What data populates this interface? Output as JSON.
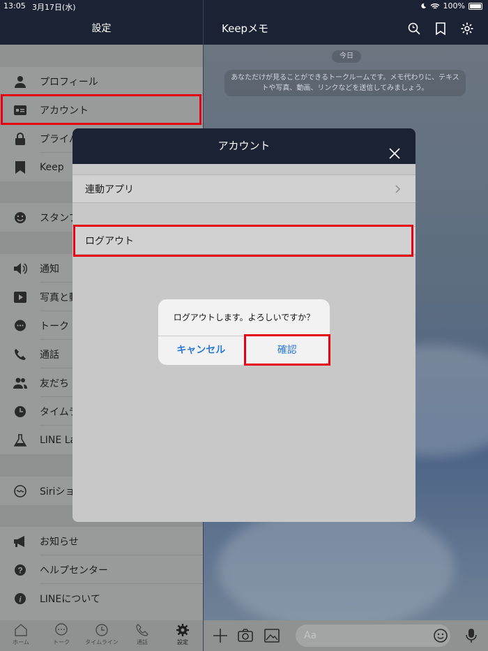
{
  "status": {
    "time": "13:05",
    "date": "3月17日(水)",
    "battery": "100%"
  },
  "left_nav": {
    "title": "設定"
  },
  "right_nav": {
    "title": "Keepメモ",
    "icons": [
      "search-icon",
      "bookmark-icon",
      "gear-icon"
    ]
  },
  "settings": {
    "items": [
      {
        "label": "プロフィール",
        "icon": "person-icon"
      },
      {
        "label": "アカウント",
        "icon": "id-card-icon"
      },
      {
        "label": "プライバ",
        "icon": "lock-icon"
      },
      {
        "label": "Keep",
        "icon": "bookmark-icon"
      },
      {
        "label": "スタンプ",
        "icon": "smile-icon"
      },
      {
        "label": "通知",
        "icon": "speaker-icon"
      },
      {
        "label": "写真と動",
        "icon": "play-icon"
      },
      {
        "label": "トーク",
        "icon": "chat-bubble-icon"
      },
      {
        "label": "通話",
        "icon": "phone-icon"
      },
      {
        "label": "友だち",
        "icon": "friends-icon"
      },
      {
        "label": "タイムラ",
        "icon": "clock-icon"
      },
      {
        "label": "LINE La",
        "icon": "flask-icon"
      },
      {
        "label": "Siriショ",
        "icon": "siri-icon"
      },
      {
        "label": "お知らせ",
        "icon": "megaphone-icon"
      },
      {
        "label": "ヘルプセンター",
        "icon": "question-icon"
      },
      {
        "label": "LINEについて",
        "icon": "info-icon"
      }
    ]
  },
  "chat": {
    "day_label": "今日",
    "notice": "あなただけが見ることができるトークルームです。メモ代わりに、テキストや写真、動画、リンクなどを送信してみましょう。",
    "input_placeholder": "Aa"
  },
  "tabbar": {
    "tabs": [
      {
        "label": "ホーム",
        "icon": "home-icon"
      },
      {
        "label": "トーク",
        "icon": "chat-icon"
      },
      {
        "label": "タイムライン",
        "icon": "clock-icon"
      },
      {
        "label": "通話",
        "icon": "phone-icon"
      },
      {
        "label": "設定",
        "icon": "gear-icon"
      }
    ]
  },
  "modal": {
    "title": "アカウント",
    "rows": [
      {
        "label": "連動アプリ"
      },
      {
        "label": "ログアウト"
      }
    ]
  },
  "alert": {
    "message": "ログアウトします。よろしいですか？",
    "cancel": "キャンセル",
    "confirm": "確認"
  },
  "colors": {
    "nav_bg": "#1b2233",
    "highlight": "#e50012",
    "link_blue": "#2c7ad6"
  }
}
